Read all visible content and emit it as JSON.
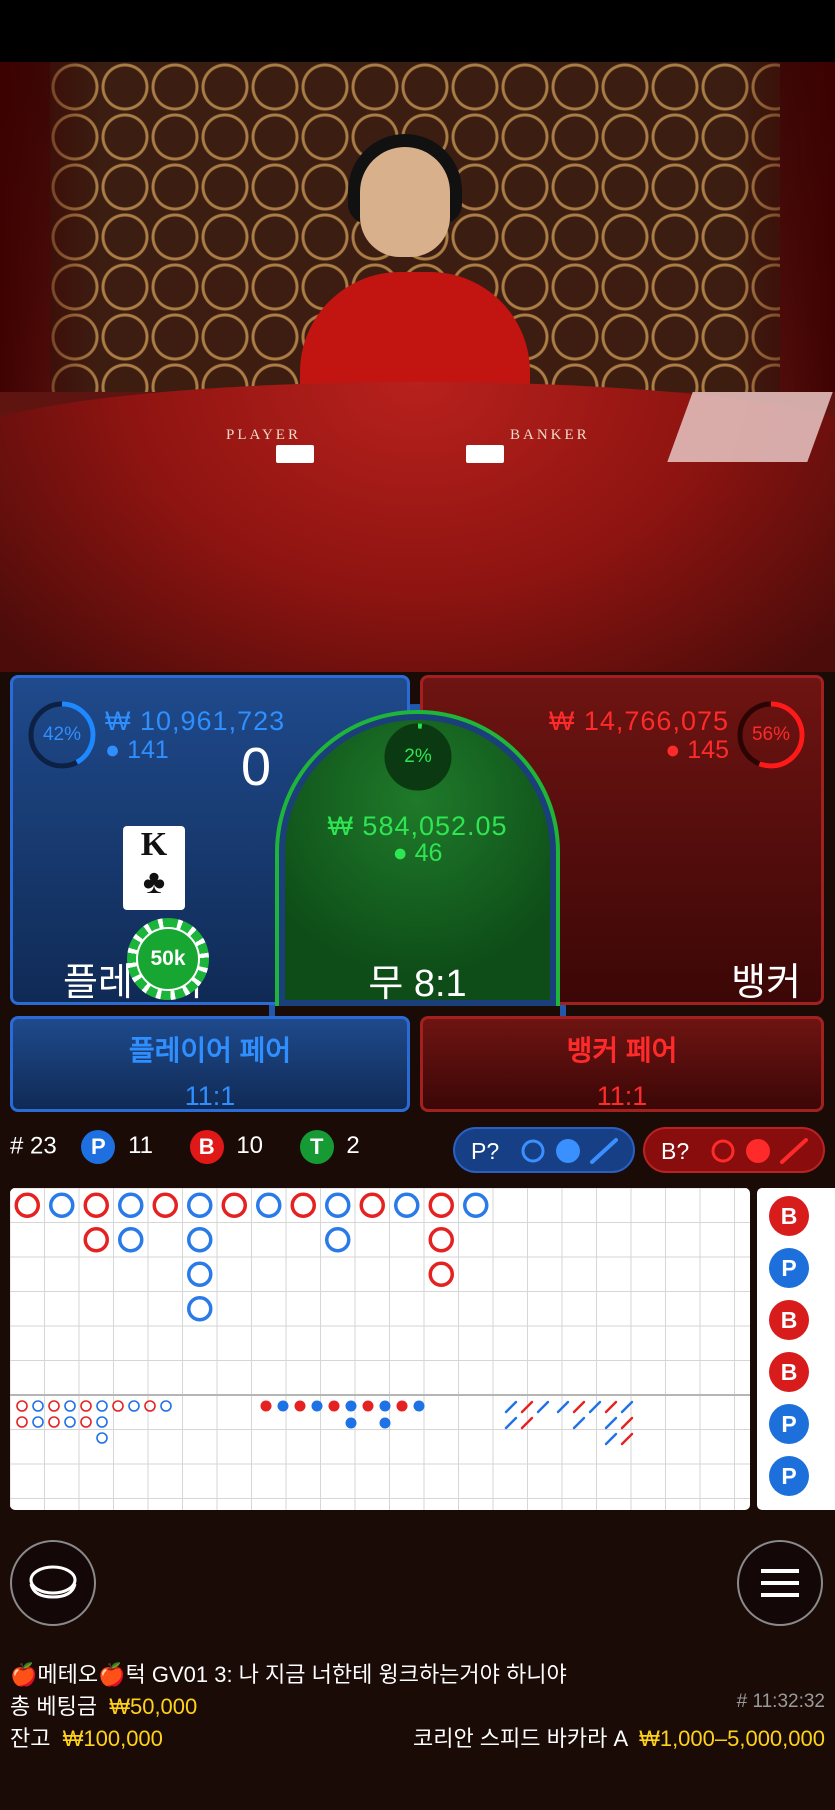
{
  "video": {
    "table_left_label": "PLAYER",
    "table_right_label": "BANKER"
  },
  "player": {
    "percent": "42%",
    "percent_value": 42,
    "amount": "₩ 10,961,723",
    "bettors": "141",
    "score": "0",
    "card_rank": "K",
    "card_suit": "♣",
    "chip": "50k",
    "label": "플레이어"
  },
  "tie": {
    "percent": "2%",
    "percent_value": 2,
    "amount": "₩ 584,052.05",
    "bettors": "46",
    "label": "무 8:1"
  },
  "banker": {
    "percent": "56%",
    "percent_value": 56,
    "amount": "₩ 14,766,075",
    "bettors": "145",
    "label": "뱅커"
  },
  "player_pair": {
    "label": "플레이어 페어",
    "odds": "11:1"
  },
  "banker_pair": {
    "label": "뱅커 페어",
    "odds": "11:1"
  },
  "stats": {
    "round": "# 23",
    "player_letter": "P",
    "player_count": "11",
    "banker_letter": "B",
    "banker_count": "10",
    "tie_letter": "T",
    "tie_count": "2"
  },
  "predict": {
    "player_label": "P?",
    "banker_label": "B?"
  },
  "colors": {
    "player": "#1e88ff",
    "banker": "#ff1a1a",
    "tie": "#1fa33a",
    "gold": "#ffd21a"
  },
  "bead_side": [
    "B",
    "P",
    "B",
    "B",
    "P",
    "P"
  ],
  "big_road": [
    {
      "col": 0,
      "row": 0,
      "c": "r"
    },
    {
      "col": 1,
      "row": 0,
      "c": "b"
    },
    {
      "col": 2,
      "row": 0,
      "c": "r"
    },
    {
      "col": 2,
      "row": 1,
      "c": "r"
    },
    {
      "col": 3,
      "row": 0,
      "c": "b"
    },
    {
      "col": 3,
      "row": 1,
      "c": "b"
    },
    {
      "col": 4,
      "row": 0,
      "c": "r"
    },
    {
      "col": 5,
      "row": 0,
      "c": "b"
    },
    {
      "col": 5,
      "row": 1,
      "c": "b"
    },
    {
      "col": 5,
      "row": 2,
      "c": "b"
    },
    {
      "col": 5,
      "row": 3,
      "c": "b"
    },
    {
      "col": 6,
      "row": 0,
      "c": "r"
    },
    {
      "col": 7,
      "row": 0,
      "c": "b"
    },
    {
      "col": 8,
      "row": 0,
      "c": "r"
    },
    {
      "col": 9,
      "row": 0,
      "c": "b"
    },
    {
      "col": 9,
      "row": 1,
      "c": "b"
    },
    {
      "col": 10,
      "row": 0,
      "c": "r"
    },
    {
      "col": 11,
      "row": 0,
      "c": "b"
    },
    {
      "col": 12,
      "row": 0,
      "c": "r"
    },
    {
      "col": 12,
      "row": 1,
      "c": "r"
    },
    {
      "col": 12,
      "row": 2,
      "c": "r"
    },
    {
      "col": 13,
      "row": 0,
      "c": "b"
    }
  ],
  "footer": {
    "chat": "🍎메테오🍎턱 GV01 3: 나 지금 너한테 윙크하는거야 하니야",
    "total_bet_label": "총 베팅금",
    "total_bet_value": "₩50,000",
    "time": "# 11:32:32",
    "balance_label": "잔고",
    "balance_value": "₩100,000",
    "table_name": "코리안 스피드 바카라 A",
    "limits": "₩1,000–5,000,000"
  }
}
